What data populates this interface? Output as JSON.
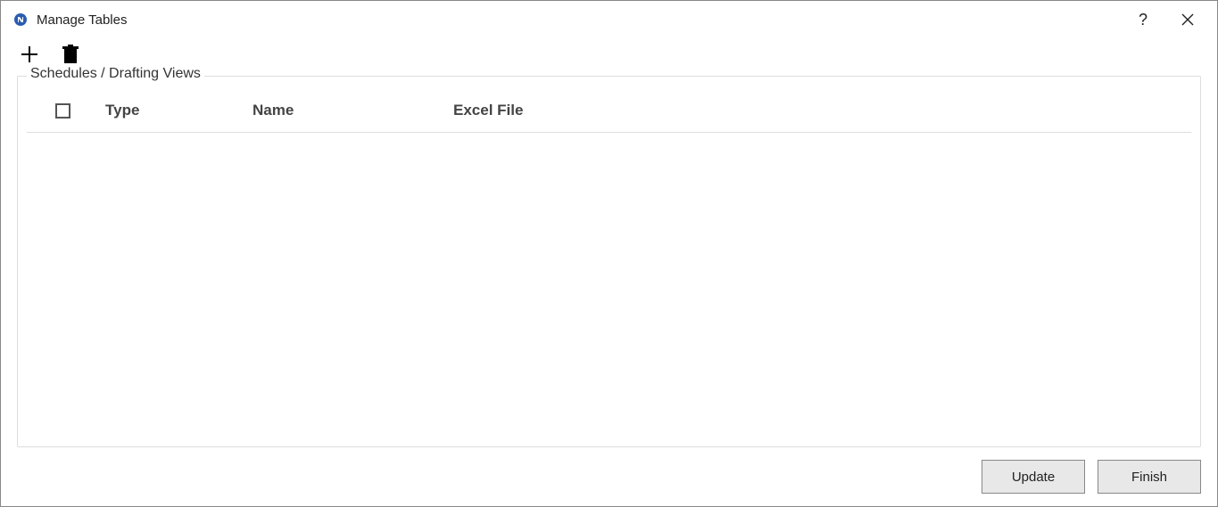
{
  "titlebar": {
    "title": "Manage Tables",
    "help_label": "?",
    "close_label": "Close"
  },
  "toolbar": {
    "add_label": "Add",
    "delete_label": "Delete"
  },
  "group": {
    "label": "Schedules / Drafting Views"
  },
  "table": {
    "headers": {
      "type": "Type",
      "name": "Name",
      "excel_file": "Excel File"
    },
    "rows": []
  },
  "footer": {
    "update_label": "Update",
    "finish_label": "Finish"
  }
}
